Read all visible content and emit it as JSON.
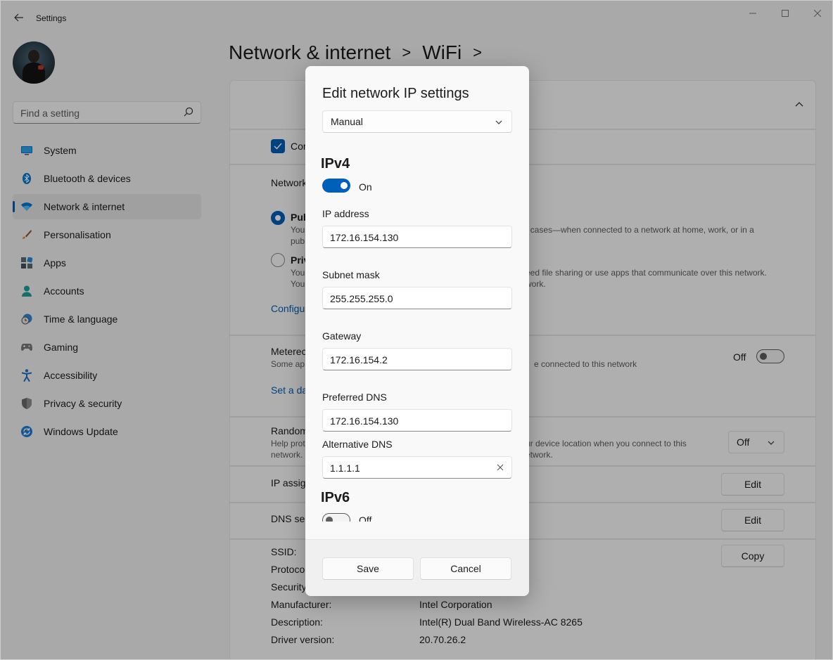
{
  "window": {
    "title": "Settings"
  },
  "sidebar": {
    "search_placeholder": "Find a setting",
    "items": [
      {
        "label": "System",
        "icon": "monitor-icon"
      },
      {
        "label": "Bluetooth & devices",
        "icon": "bluetooth-icon"
      },
      {
        "label": "Network & internet",
        "icon": "wifi-icon",
        "active": true
      },
      {
        "label": "Personalisation",
        "icon": "brush-icon"
      },
      {
        "label": "Apps",
        "icon": "apps-icon"
      },
      {
        "label": "Accounts",
        "icon": "person-icon"
      },
      {
        "label": "Time & language",
        "icon": "clock-globe-icon"
      },
      {
        "label": "Gaming",
        "icon": "gamepad-icon"
      },
      {
        "label": "Accessibility",
        "icon": "accessibility-icon"
      },
      {
        "label": "Privacy & security",
        "icon": "shield-icon"
      },
      {
        "label": "Windows Update",
        "icon": "sync-icon"
      }
    ]
  },
  "breadcrumb": {
    "part1": "Network & internet",
    "separator": ">",
    "part2": "WiFi",
    "separator2": ">"
  },
  "background": {
    "connect_check_fragment": "Con",
    "network_fragment": "Network",
    "public_fragment": "Pub",
    "public_line1_fragment": "You",
    "public_line1_right": "t cases—when connected to a network at home, work, or in a",
    "public_line2_fragment": "pub",
    "private_fragment": "Priv",
    "private_line1_fragment": "You",
    "private_line1_right": "eed file sharing or use apps that communicate over this network.",
    "private_line2_fragment": "You",
    "private_line2_right": "work.",
    "configure_fragment": "Configu",
    "metered_fragment": "Meterec",
    "metered_sub_fragment": "Some ap",
    "metered_sub_right": "e connected to this network",
    "metered_toggle_label": "Off",
    "set_data_fragment": "Set a da",
    "random_fragment": "Random",
    "random_sub1_fragment": "Help prot",
    "random_sub1_right": "ur device location when you connect to this",
    "random_sub2_fragment": "network.",
    "random_sub2_right": "etwork.",
    "random_select_value": "Off",
    "ip_assign_fragment": "IP assign",
    "dns_fragment": "DNS ser",
    "edit_label": "Edit",
    "copy_label": "Copy",
    "props": [
      {
        "label": "SSID:",
        "value": ""
      },
      {
        "label": "Protoco",
        "value": ""
      },
      {
        "label": "Security",
        "value": ""
      },
      {
        "label": "Manufacturer:",
        "value": "Intel Corporation"
      },
      {
        "label": "Description:",
        "value": "Intel(R) Dual Band Wireless-AC 8265"
      },
      {
        "label": "Driver version:",
        "value": "20.70.26.2"
      }
    ]
  },
  "dialog": {
    "title": "Edit network IP settings",
    "mode_select": "Manual",
    "ipv4_heading": "IPv4",
    "ipv4_toggle_label": "On",
    "ip_address_label": "IP address",
    "ip_address_value": "172.16.154.130",
    "subnet_label": "Subnet mask",
    "subnet_value": "255.255.255.0",
    "gateway_label": "Gateway",
    "gateway_value": "172.16.154.2",
    "pref_dns_label": "Preferred DNS",
    "pref_dns_value": "172.16.154.130",
    "alt_dns_label": "Alternative DNS",
    "alt_dns_value": "1.1.1.1",
    "ipv6_heading": "IPv6",
    "ipv6_toggle_label": "Off",
    "save_label": "Save",
    "cancel_label": "Cancel"
  },
  "colors": {
    "accent": "#005fb8",
    "background": "#f3f3f3",
    "card": "#fbfbfb"
  }
}
